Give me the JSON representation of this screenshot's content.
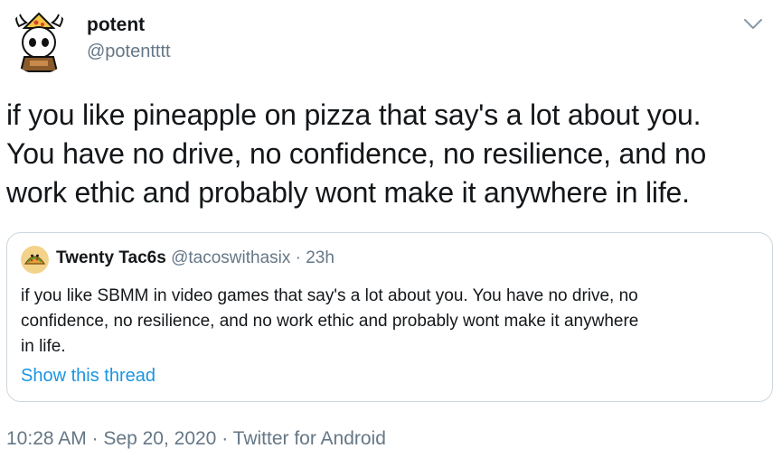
{
  "author": {
    "display_name": "potent",
    "handle": "@potentttt",
    "avatar_icon": "viking-pizza-mascot-icon"
  },
  "menu_icon": "chevron-down-icon",
  "tweet": {
    "lines": [
      "if you like pineapple on pizza that say's a lot about you.",
      "You have no drive, no confidence, no resilience, and no",
      "work ethic and probably wont make it anywhere in life."
    ]
  },
  "quote": {
    "avatar_icon": "taco-avatar-icon",
    "display_name": "Twenty Tac6s",
    "meta": " @tacoswithasix · 23h",
    "lines": [
      "if you like SBMM in video games that say's a lot about you. You have no drive, no",
      "confidence, no resilience, and no work ethic and probably wont make it anywhere",
      "in life."
    ],
    "show_thread": "Show this thread"
  },
  "footer": {
    "time": "10:28 AM",
    "sep1": " · ",
    "date": "Sep 20, 2020",
    "sep2": " · ",
    "source": "Twitter for Android"
  },
  "colors": {
    "text": "#14171a",
    "secondary": "#657786",
    "link": "#1b95e0",
    "border": "#ccd6dd"
  }
}
